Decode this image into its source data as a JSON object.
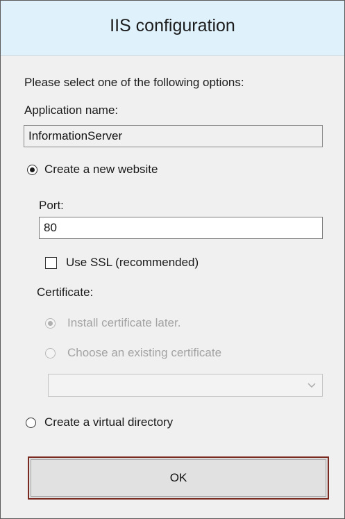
{
  "dialog": {
    "title": "IIS configuration",
    "instruction": "Please select one of the following options:",
    "app_name_label": "Application name:",
    "app_name_value": "InformationServer",
    "option_new_website": "Create a new website",
    "port_label": "Port:",
    "port_value": "80",
    "use_ssl_label": "Use SSL (recommended)",
    "certificate_label": "Certificate:",
    "cert_install_later": "Install certificate later.",
    "cert_choose_existing": "Choose an existing certificate",
    "certificate_select_value": "",
    "option_virtual_directory": "Create a virtual directory",
    "ok_label": "OK"
  },
  "state": {
    "selected_option": "Create a new website",
    "use_ssl_checked": false,
    "certificate_choice": "Install certificate later.",
    "certificate_section_enabled": false
  },
  "colors": {
    "title_bar": "#dff1fb",
    "window_bg": "#f0f0f0",
    "ok_focus_border": "#7b2a22",
    "disabled_text": "#a3a3a3"
  },
  "icons": [
    "radio-selected",
    "radio-unselected",
    "checkbox-unchecked",
    "chevron-down-icon"
  ]
}
